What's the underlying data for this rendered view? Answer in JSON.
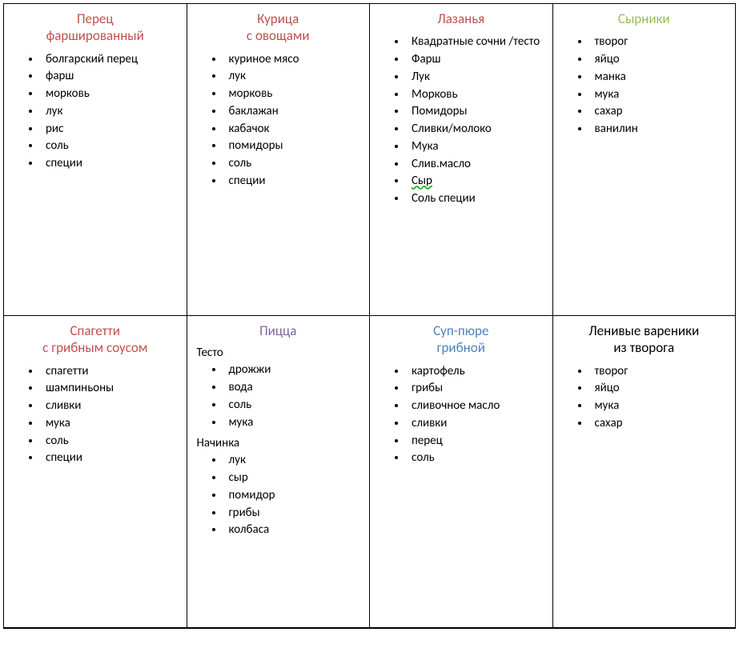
{
  "cards": [
    {
      "title": "Перец\nфаршированный",
      "title_color": "red",
      "sections": [
        {
          "heading": null,
          "items": [
            "болгарский перец",
            "фарш",
            "морковь",
            "лук",
            "рис",
            "соль",
            "специи"
          ]
        }
      ]
    },
    {
      "title": "Курица\nс овощами",
      "title_color": "red",
      "sections": [
        {
          "heading": null,
          "items": [
            "куриное мясо",
            "лук",
            "морковь",
            "баклажан",
            "кабачок",
            "помидоры",
            "соль",
            "специи"
          ]
        }
      ]
    },
    {
      "title": "Лазанья",
      "title_color": "red",
      "sections": [
        {
          "heading": null,
          "items": [
            "Квадратные сочни /тесто",
            "Фарш",
            "Лук",
            "Морковь",
            "Помидоры",
            "Сливки/молоко",
            "Мука",
            "Слив.масло",
            "Сыр",
            "Соль специи"
          ],
          "spellcheck_error_index": 8,
          "spellcheck_error_part": "Слив.масло"
        }
      ]
    },
    {
      "title": "Сырники",
      "title_color": "olive",
      "sections": [
        {
          "heading": null,
          "items": [
            "творог",
            "яйцо",
            "манка",
            "мука",
            "сахар",
            "ванилин"
          ]
        }
      ]
    },
    {
      "title": "Спагетти\nс грибным соусом",
      "title_color": "red",
      "sections": [
        {
          "heading": null,
          "items": [
            "спагетти",
            "шампиньоны",
            "сливки",
            "мука",
            "соль",
            "специи"
          ]
        }
      ]
    },
    {
      "title": "Пицца",
      "title_color": "purple",
      "sections": [
        {
          "heading": "Тесто",
          "items": [
            "дрожжи",
            "вода",
            "соль",
            "мука"
          ]
        },
        {
          "heading": "Начинка",
          "items": [
            "лук",
            "сыр",
            "помидор",
            "грибы",
            "колбаса"
          ]
        }
      ]
    },
    {
      "title": "Суп-пюре\nгрибной",
      "title_color": "blue",
      "sections": [
        {
          "heading": null,
          "items": [
            "картофель",
            "грибы",
            "сливочное масло",
            "сливки",
            "перец",
            "соль"
          ]
        }
      ]
    },
    {
      "title": "Ленивые вареники\nиз творога",
      "title_color": "black",
      "sections": [
        {
          "heading": null,
          "items": [
            "творог",
            "яйцо",
            "мука",
            "сахар"
          ]
        }
      ]
    }
  ]
}
